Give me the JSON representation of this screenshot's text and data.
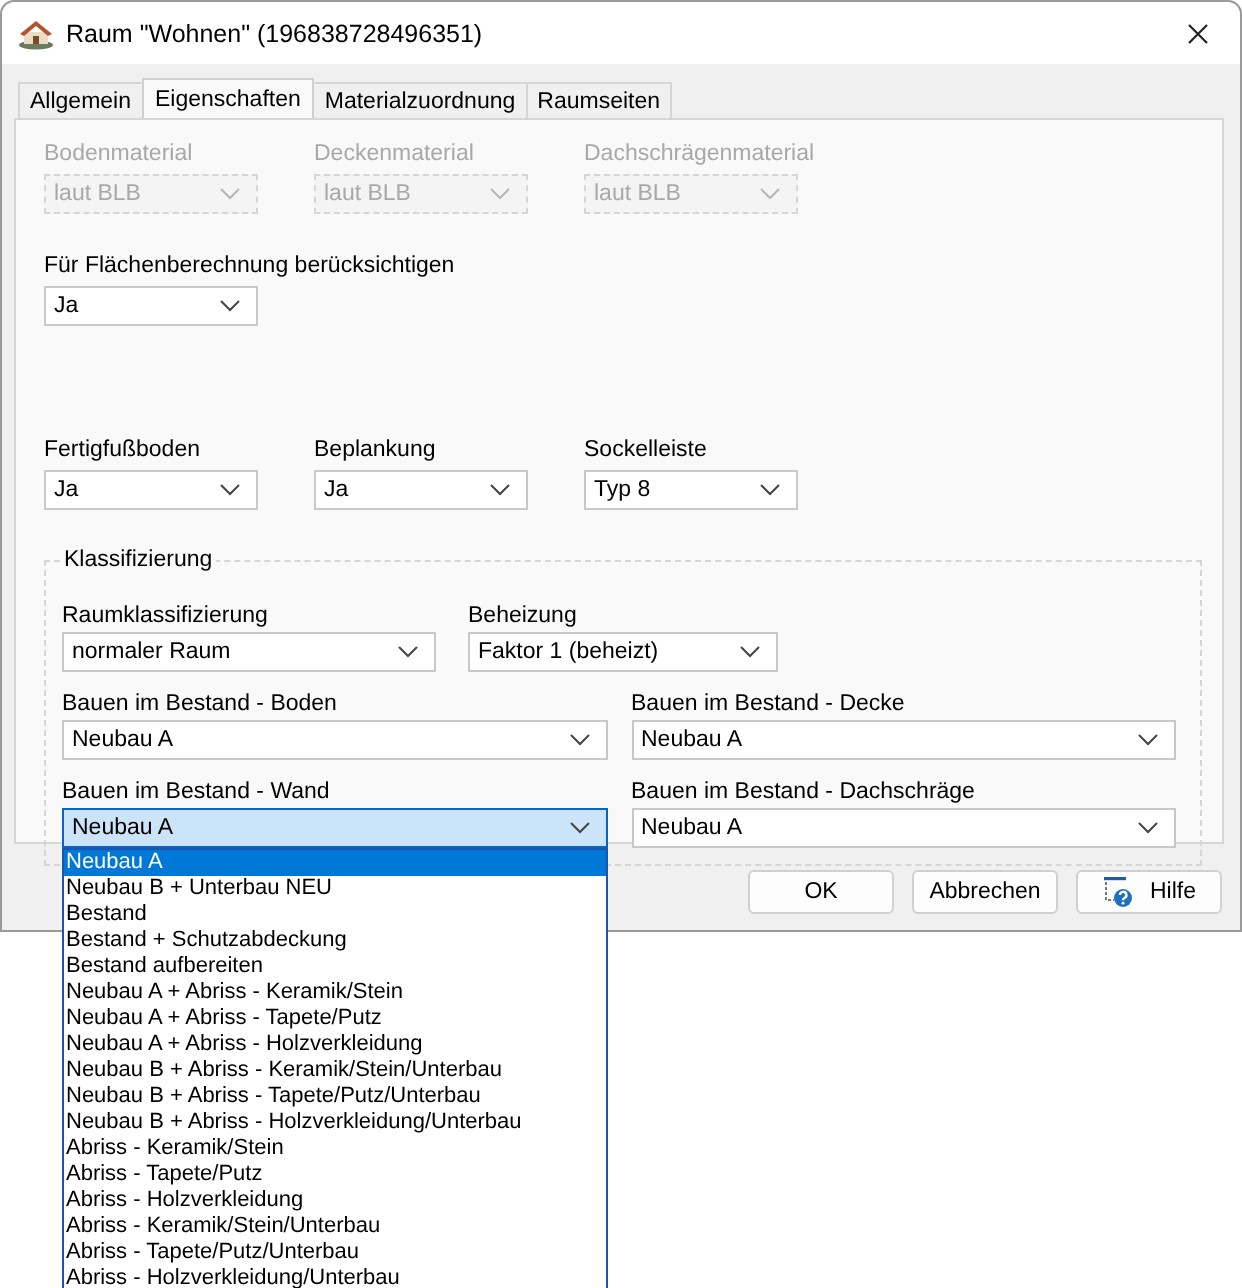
{
  "window": {
    "title": "Raum \"Wohnen\" (196838728496351)"
  },
  "tabs": [
    {
      "label": "Allgemein",
      "selected": false
    },
    {
      "label": "Eigenschaften",
      "selected": true
    },
    {
      "label": "Materialzuordnung",
      "selected": false
    },
    {
      "label": "Raumseiten",
      "selected": false
    }
  ],
  "material_fields": [
    {
      "label": "Bodenmaterial",
      "value": "laut BLB",
      "disabled": true
    },
    {
      "label": "Deckenmaterial",
      "value": "laut BLB",
      "disabled": true
    },
    {
      "label": "Dachschrägenmaterial",
      "value": "laut BLB",
      "disabled": true
    }
  ],
  "area_field": {
    "label": "Für Flächenberechnung berücksichtigen",
    "value": "Ja",
    "disabled": false
  },
  "finish_fields": [
    {
      "label": "Fertigfußboden",
      "value": "Ja",
      "disabled": false
    },
    {
      "label": "Beplankung",
      "value": "Ja",
      "disabled": false
    },
    {
      "label": "Sockelleiste",
      "value": "Typ 8",
      "disabled": false
    }
  ],
  "classification": {
    "title": "Klassifizierung",
    "rows": [
      [
        {
          "label": "Raumklassifizierung",
          "value": "normaler Raum",
          "open": false
        },
        {
          "label": "Beheizung",
          "value": "Faktor 1 (beheizt)",
          "open": false
        }
      ],
      [
        {
          "label": "Bauen im Bestand - Boden",
          "value": "Neubau A",
          "open": false
        },
        {
          "label": "Bauen im Bestand - Decke",
          "value": "Neubau A",
          "open": false
        }
      ],
      [
        {
          "label": "Bauen im Bestand - Wand",
          "value": "Neubau A",
          "open": true
        },
        {
          "label": "Bauen im Bestand - Dachschräge",
          "value": "Neubau A",
          "open": false
        }
      ]
    ]
  },
  "dropdown": {
    "items": [
      {
        "label": "Neubau A",
        "selected": true
      },
      {
        "label": "Neubau B + Unterbau NEU",
        "selected": false
      },
      {
        "label": "Bestand",
        "selected": false
      },
      {
        "label": "Bestand + Schutzabdeckung",
        "selected": false
      },
      {
        "label": "Bestand aufbereiten",
        "selected": false
      },
      {
        "label": "Neubau A + Abriss - Keramik/Stein",
        "selected": false
      },
      {
        "label": "Neubau A + Abriss - Tapete/Putz",
        "selected": false
      },
      {
        "label": "Neubau A + Abriss - Holzverkleidung",
        "selected": false
      },
      {
        "label": "Neubau B + Abriss - Keramik/Stein/Unterbau",
        "selected": false
      },
      {
        "label": "Neubau B + Abriss - Tapete/Putz/Unterbau",
        "selected": false
      },
      {
        "label": "Neubau B + Abriss - Holzverkleidung/Unterbau",
        "selected": false
      },
      {
        "label": "Abriss - Keramik/Stein",
        "selected": false
      },
      {
        "label": "Abriss - Tapete/Putz",
        "selected": false
      },
      {
        "label": "Abriss - Holzverkleidung",
        "selected": false
      },
      {
        "label": "Abriss - Keramik/Stein/Unterbau",
        "selected": false
      },
      {
        "label": "Abriss - Tapete/Putz/Unterbau",
        "selected": false
      },
      {
        "label": "Abriss - Holzverkleidung/Unterbau",
        "selected": false
      }
    ]
  },
  "buttons": [
    {
      "label": "OK",
      "kind": "plain"
    },
    {
      "label": "Abbrechen",
      "kind": "plain"
    },
    {
      "label": "Hilfe",
      "kind": "help"
    }
  ]
}
